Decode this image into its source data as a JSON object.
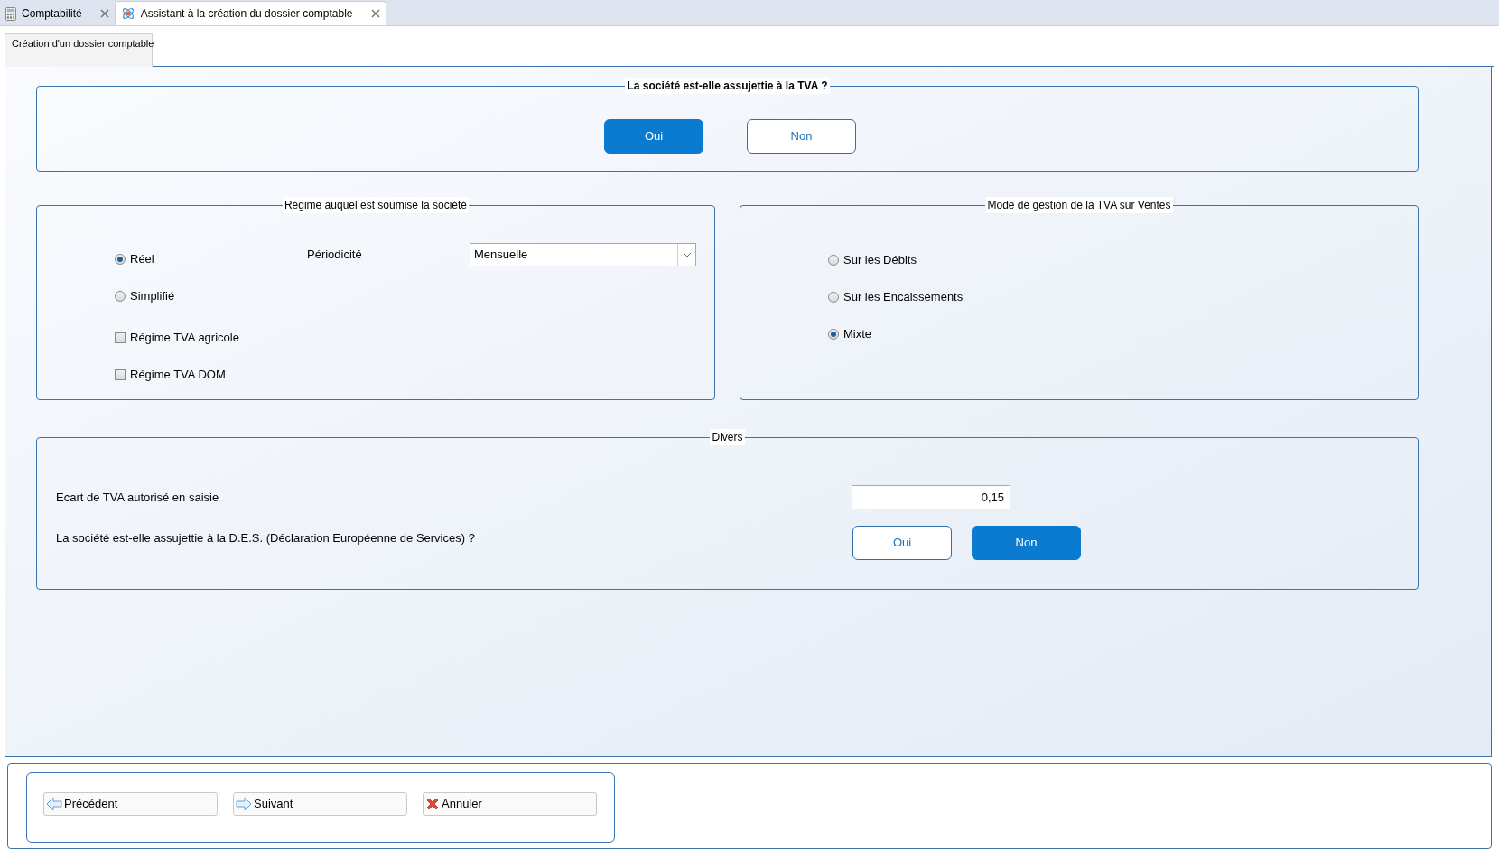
{
  "tabs": [
    {
      "label": "Comptabilité",
      "selected": false,
      "kind": "calculator"
    },
    {
      "label": "Assistant à la création du dossier comptable",
      "selected": true,
      "kind": "atom"
    }
  ],
  "page_tab": {
    "label": "Création d'un dossier comptable"
  },
  "tva_question": {
    "title": "La société est-elle assujettie à la TVA ?",
    "options": [
      {
        "label": "Oui",
        "selected": true
      },
      {
        "label": "Non",
        "selected": false
      }
    ]
  },
  "regime": {
    "title": "Régime auquel est soumise la société",
    "radios": [
      {
        "label": "Réel",
        "selected": true
      },
      {
        "label": "Simplifié",
        "selected": false
      }
    ],
    "periodicity": {
      "label": "Périodicité",
      "value": "Mensuelle"
    },
    "checkboxes": [
      {
        "label": "Régime TVA agricole",
        "checked": false
      },
      {
        "label": "Régime TVA DOM",
        "checked": false
      }
    ]
  },
  "mode": {
    "title": "Mode de gestion de la TVA sur Ventes",
    "radios": [
      {
        "label": "Sur les Débits",
        "selected": false
      },
      {
        "label": "Sur les Encaissements",
        "selected": false
      },
      {
        "label": "Mixte",
        "selected": true
      }
    ]
  },
  "divers": {
    "title": "Divers",
    "ecart_label": "Ecart de TVA autorisé en saisie",
    "ecart_value": "0,15",
    "des_question": "La société est-elle assujettie à la D.E.S. (Déclaration Européenne de Services) ?",
    "des_options": [
      {
        "label": "Oui",
        "selected": false
      },
      {
        "label": "Non",
        "selected": true
      }
    ]
  },
  "footer_buttons": [
    {
      "label": "Précédent",
      "kind": "back"
    },
    {
      "label": "Suivant",
      "kind": "next"
    },
    {
      "label": "Annuler",
      "kind": "cancel"
    }
  ]
}
